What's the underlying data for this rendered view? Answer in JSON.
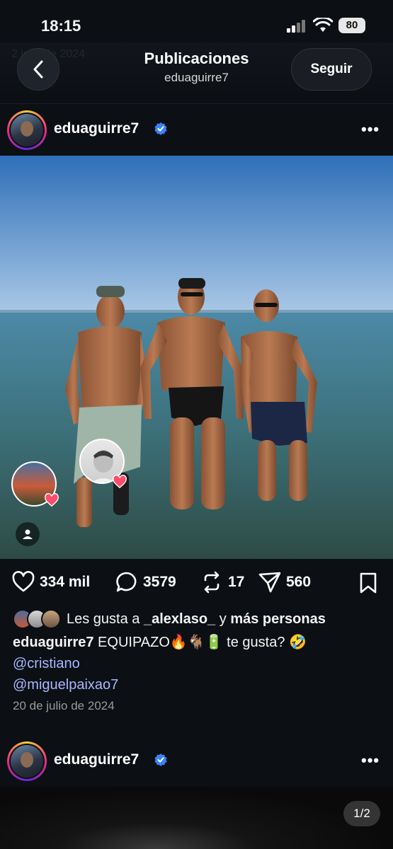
{
  "status_bar": {
    "time": "18:15",
    "battery": "80"
  },
  "header": {
    "title": "Publicaciones",
    "subtitle": "eduaguirre7",
    "follow_label": "Seguir",
    "ghost_text": "2       julio de 2024"
  },
  "post": {
    "username": "eduaguirre7",
    "likes_count": "334 mil",
    "comments_count": "3579",
    "reposts_count": "17",
    "shares_count": "560",
    "liked_by_prefix": "Les gusta a",
    "liked_by_user": "_alexlaso_",
    "liked_by_join": "y",
    "liked_by_suffix": "más personas",
    "caption_user": "eduaguirre7",
    "caption_text": "EQUIPAZO🔥🐐🔋 te gusta? 🤣",
    "mentions": [
      "@cristiano",
      "@miguelpaixao7"
    ],
    "date": "20 de julio de 2024"
  },
  "next_post": {
    "username": "eduaguirre7",
    "page_indicator": "1/2"
  },
  "colors": {
    "background": "#0c0f14",
    "mention": "#a6b8ff",
    "verified": "#3b82f6",
    "heart": "#ff4d6d"
  }
}
